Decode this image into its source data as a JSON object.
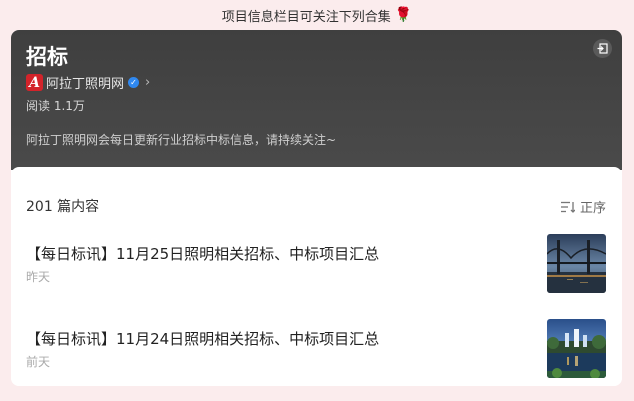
{
  "banner": {
    "text": "项目信息栏目可关注下列合集",
    "emoji": "🌹"
  },
  "header": {
    "title": "招标",
    "author": "阿拉丁照明网",
    "author_logo_letter": "A",
    "reads": "阅读 1.1万",
    "description": "阿拉丁照明网会每日更新行业招标中标信息，请持续关注~"
  },
  "list": {
    "count": "201 篇内容",
    "sort_label": "正序",
    "items": [
      {
        "title": "【每日标讯】11月25日照明相关招标、中标项目汇总",
        "time": "昨天",
        "thumb": "bridge-night-photo"
      },
      {
        "title": "【每日标讯】11月24日照明相关招标、中标项目汇总",
        "time": "前天",
        "thumb": "city-lake-night-photo"
      }
    ]
  },
  "colors": {
    "brand": "#d3232a",
    "header_bg": "#434343",
    "page_bg": "#fbeced",
    "verified": "#2f88f0"
  }
}
